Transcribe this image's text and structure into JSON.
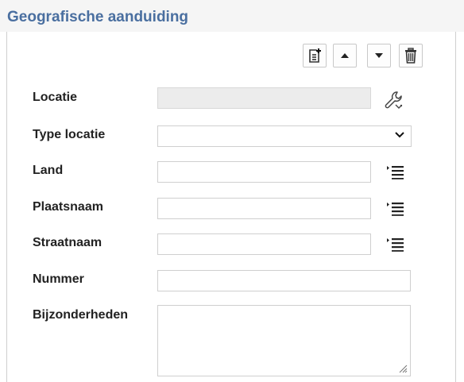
{
  "section": {
    "title": "Geografische aanduiding"
  },
  "toolbar": {
    "add_icon": "add-record-icon",
    "up_icon": "triangle-up-icon",
    "down_icon": "triangle-down-icon",
    "delete_icon": "trash-icon"
  },
  "fields": {
    "locatie": {
      "label": "Locatie",
      "value": ""
    },
    "type_locatie": {
      "label": "Type locatie",
      "value": ""
    },
    "land": {
      "label": "Land",
      "value": ""
    },
    "plaatsnaam": {
      "label": "Plaatsnaam",
      "value": ""
    },
    "straatnaam": {
      "label": "Straatnaam",
      "value": ""
    },
    "nummer": {
      "label": "Nummer",
      "value": ""
    },
    "bijzonderheden": {
      "label": "Bijzonderheden",
      "value": ""
    }
  },
  "colors": {
    "title": "#4a6fa0",
    "header_bg": "#f5f5f5",
    "readonly_bg": "#ececec",
    "border": "#cfcfcf"
  }
}
